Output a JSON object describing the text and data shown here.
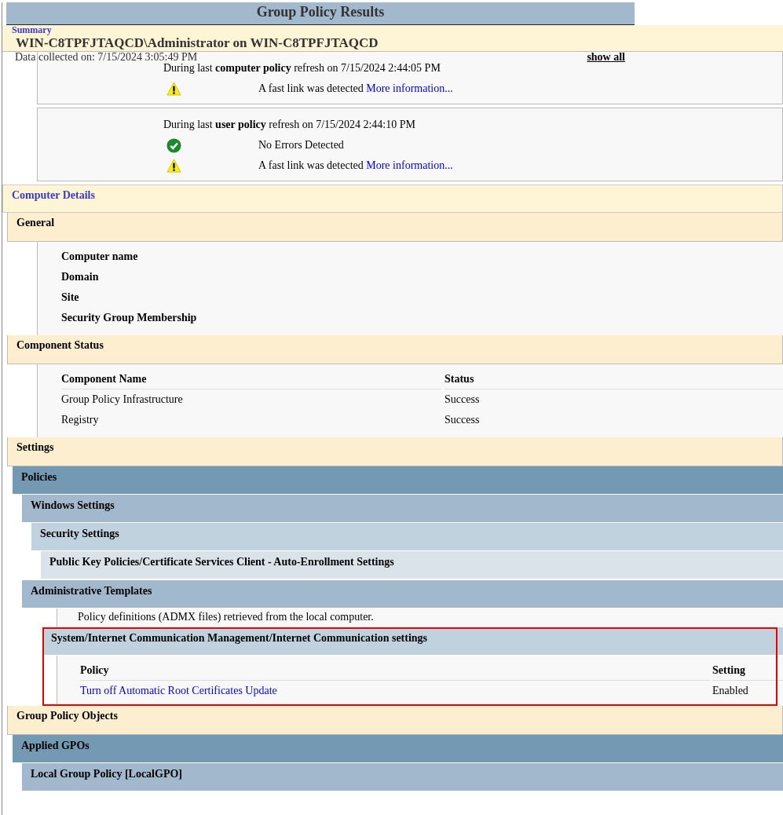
{
  "report_title": "Group Policy Results",
  "summary": {
    "link": "Summary",
    "heading": "WIN-C8TPFJTAQCD\\Administrator on WIN-C8TPFJTAQCD",
    "data_collected": "Data collected on: 7/15/2024 3:05:49 PM",
    "show_all": "show all",
    "refreshes": [
      {
        "intro": "During last **computer policy** refresh on 7/15/2024 2:44:05 PM",
        "messages": [
          {
            "kind": "warning",
            "text": "A fast link was detected",
            "link": "More information..."
          }
        ]
      },
      {
        "intro": "During last **user policy** refresh on 7/15/2024 2:44:10 PM",
        "messages": [
          {
            "kind": "success",
            "text": "No Errors Detected"
          },
          {
            "kind": "warning",
            "text": "A fast link was detected",
            "link": "More information..."
          }
        ]
      }
    ]
  },
  "computer_details": {
    "title": "Computer Details",
    "sections": [
      {
        "title": "General",
        "kind": "fields",
        "fields": [
          "Computer name",
          "Domain",
          "Site",
          "Security Group Membership"
        ]
      },
      {
        "title": "Component Status",
        "kind": "table",
        "table": {
          "columns": [
            "Component Name",
            "Status"
          ],
          "rows": [
            {
              "cells": [
                "Group Policy Infrastructure",
                "Success"
              ],
              "link": false
            },
            {
              "cells": [
                "Registry",
                "Success"
              ],
              "link": false
            }
          ]
        }
      },
      {
        "title": "Settings",
        "kind": "tree",
        "children": [
          {
            "title": "Policies",
            "children": [
              {
                "title": "Windows Settings",
                "children": [
                  {
                    "title": "Security Settings",
                    "children": [
                      {
                        "title": "Public Key Policies/Certificate Services Client - Auto-Enrollment Settings"
                      }
                    ]
                  }
                ]
              },
              {
                "title": "Administrative Templates",
                "note": "Policy definitions (ADMX files) retrieved from the local computer.",
                "children": [
                  {
                    "title": "System/Internet Communication Management/Internet Communication settings",
                    "highlighted": true,
                    "table": {
                      "columns": [
                        "Policy",
                        "Setting"
                      ],
                      "rows": [
                        {
                          "cells": [
                            "Turn off Automatic Root Certificates Update",
                            "Enabled"
                          ],
                          "link": true
                        }
                      ]
                    }
                  }
                ]
              }
            ]
          }
        ]
      },
      {
        "title": "Group Policy Objects",
        "kind": "tree",
        "children": [
          {
            "title": "Applied GPOs",
            "children": [
              {
                "title": "Local Group Policy [LocalGPO]"
              }
            ]
          }
        ]
      }
    ]
  }
}
